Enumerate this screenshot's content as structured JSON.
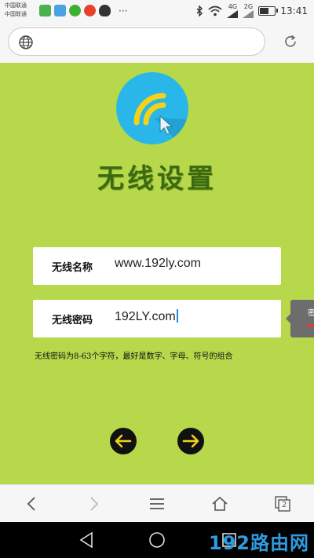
{
  "status_bar": {
    "carrier_line1": "中国联通",
    "carrier_line2": "中国联通",
    "overflow": "···",
    "network_1": "4G",
    "network_2": "2G",
    "time": "13:41",
    "battery_level": 0.55,
    "app_icons": [
      "message-icon",
      "image-icon",
      "wechat-icon",
      "weibo-icon",
      "qq-icon"
    ]
  },
  "browser": {
    "url": "",
    "url_icon": "globe-icon",
    "reload_icon": "reload-icon"
  },
  "page": {
    "title": "无线设置",
    "ssid_label": "无线名称",
    "ssid_value": "www.192ly.com",
    "password_label": "无线密码",
    "password_value": "192LY.com",
    "hint": "无线密码为8-63个字符，最好是数字、字母、符号的组合",
    "tooltip_text": "密",
    "back_icon": "arrow-left-icon",
    "next_icon": "arrow-right-icon",
    "colors": {
      "background": "#b6d84a",
      "title": "#3a6b12",
      "logo_circle": "#29b6e8",
      "logo_wifi": "#f3d21a"
    }
  },
  "toolbar": {
    "back_icon": "chevron-left-icon",
    "forward_icon": "chevron-right-icon",
    "menu_icon": "menu-icon",
    "home_icon": "home-icon",
    "tabs_count": "2"
  },
  "navbar": {
    "watermark": "192路由网"
  }
}
